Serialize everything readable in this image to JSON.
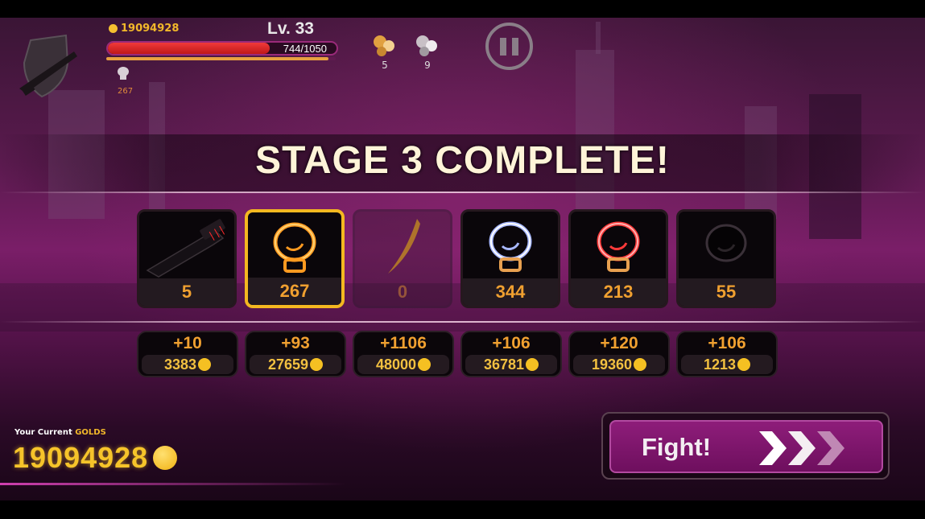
{
  "hud": {
    "gold": "19094928",
    "level": "Lv. 33",
    "hp_text": "744/1050",
    "hp_fraction": 0.709,
    "xp_fraction": 0.97,
    "glove_count": "267",
    "resource_a_count": "5",
    "resource_b_count": "9",
    "pause_icon": "pause-icon",
    "weapon_icon": "shotgun-shield-icon"
  },
  "stage": {
    "title": "STAGE 3 COMPLETE!"
  },
  "items": [
    {
      "icon": "shotgun-icon",
      "count": "5",
      "bonus": "+10",
      "cost": "3383",
      "selected": false,
      "locked": false
    },
    {
      "icon": "orange-glove-icon",
      "count": "267",
      "bonus": "+93",
      "cost": "27659",
      "selected": true,
      "locked": false
    },
    {
      "icon": "blade-icon",
      "count": "0",
      "bonus": "+1106",
      "cost": "48000",
      "selected": false,
      "locked": true
    },
    {
      "icon": "blue-glove-icon",
      "count": "344",
      "bonus": "+106",
      "cost": "36781",
      "selected": false,
      "locked": false
    },
    {
      "icon": "red-glove-icon",
      "count": "213",
      "bonus": "+120",
      "cost": "19360",
      "selected": false,
      "locked": false
    },
    {
      "icon": "black-glove-icon",
      "count": "55",
      "bonus": "+106",
      "cost": "1213",
      "selected": false,
      "locked": false
    }
  ],
  "footer": {
    "your_current": "Your Current",
    "golds_word": "GOLDS",
    "gold_total": "19094928",
    "fight_label": "Fight!"
  },
  "colors": {
    "accent_orange": "#f0a030",
    "gold": "#f6c42a",
    "selected_border": "#f4b820",
    "fight_button": "#8e1d7a"
  }
}
